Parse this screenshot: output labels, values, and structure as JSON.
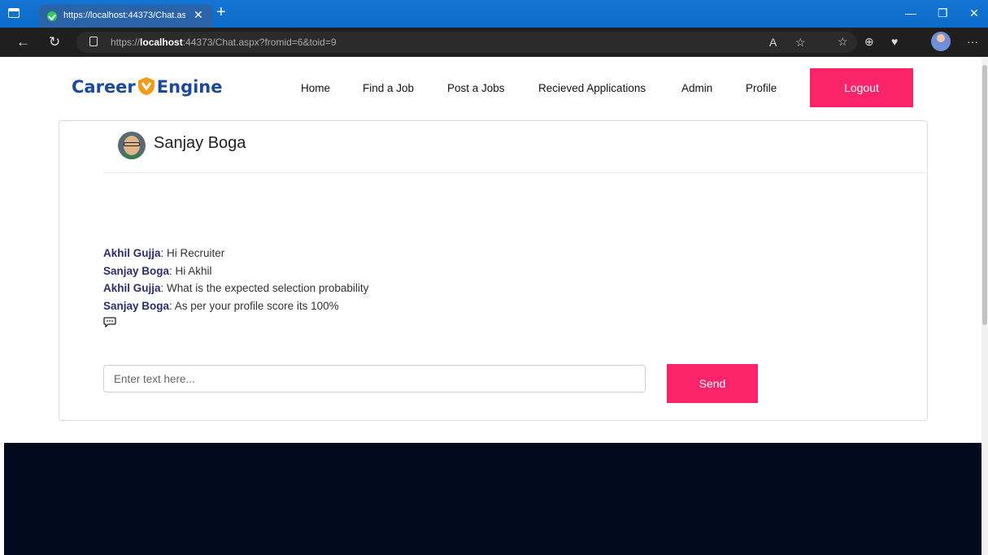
{
  "browser": {
    "tab_title": "https://localhost:44373/Chat.aspx",
    "url_prefix": "https://",
    "url_host": "localhost",
    "url_rest": ":44373/Chat.aspx?fromid=6&toid=9"
  },
  "header": {
    "logo_left": "Career",
    "logo_right": "Engine",
    "nav": [
      "Home",
      "Find a Job",
      "Post a Jobs",
      "Recieved Applications",
      "Admin",
      "Profile"
    ],
    "logout_label": "Logout"
  },
  "chat": {
    "contact_name": "Sanjay Boga",
    "messages": [
      {
        "sender": "Akhil Gujja",
        "text": ": Hi Recruiter"
      },
      {
        "sender": "Sanjay Boga",
        "text": ": Hi Akhil"
      },
      {
        "sender": "Akhil Gujja",
        "text": ": What is the expected selection probability"
      },
      {
        "sender": "Sanjay Boga",
        "text": ": As per your profile score its 100%"
      }
    ],
    "input_placeholder": "Enter text here...",
    "send_label": "Send"
  },
  "colors": {
    "accent": "#fb246a",
    "logo": "#1b4a9c",
    "sender": "#2f2d6e",
    "footer": "#010b1d"
  }
}
